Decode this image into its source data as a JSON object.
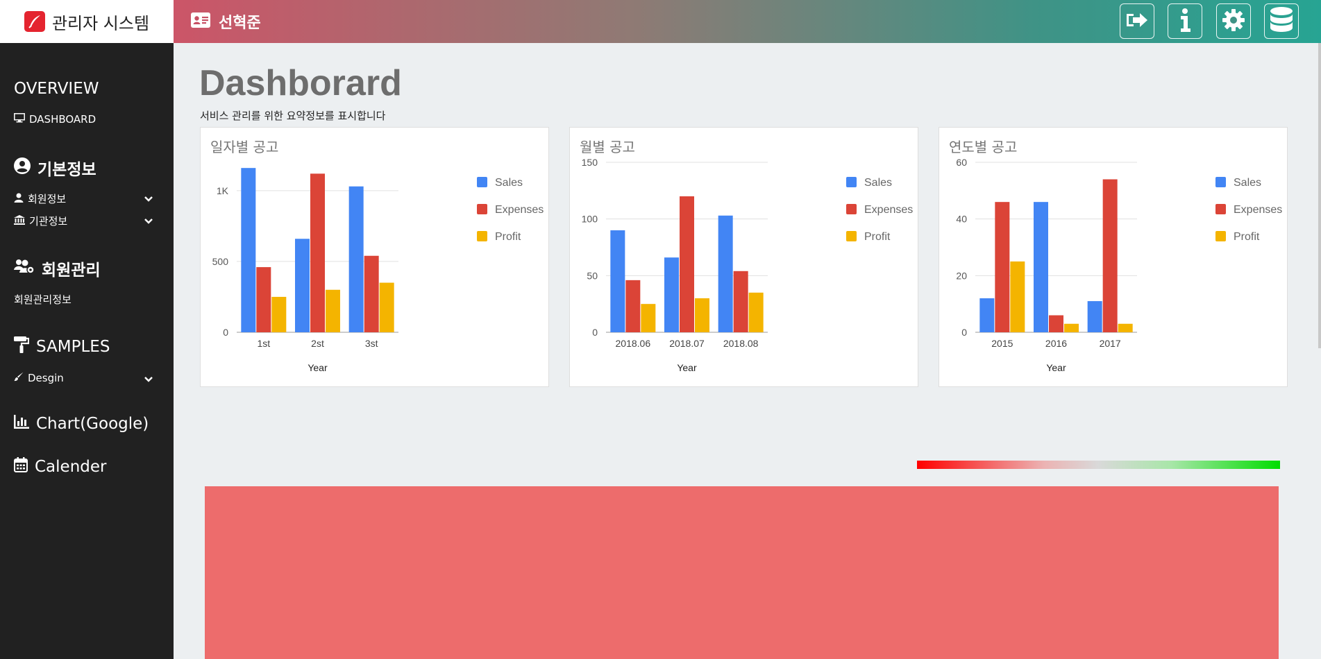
{
  "brand": {
    "title": "관리자 시스템",
    "logo_icon": "quill-icon",
    "logo_color": "#e4242f"
  },
  "header": {
    "user_name": "선혁준",
    "user_icon": "id-card-icon",
    "buttons": [
      "sign-out-icon",
      "info-icon",
      "gear-icon",
      "database-icon"
    ]
  },
  "sidebar": {
    "overview": {
      "title": "OVERVIEW",
      "items": [
        {
          "label": "DASHBOARD",
          "icon": "monitor-icon"
        }
      ]
    },
    "basic": {
      "title": "기본정보",
      "icon": "user-circle-icon",
      "items": [
        {
          "label": "회원정보",
          "icon": "user-icon"
        },
        {
          "label": "기관정보",
          "icon": "institution-icon"
        }
      ]
    },
    "members": {
      "title": "회원관리",
      "icon": "users-gear-icon",
      "items": [
        {
          "label": "회원관리정보"
        }
      ]
    },
    "samples": {
      "title": "SAMPLES",
      "icon": "paint-roller-icon",
      "items": [
        {
          "label": "Desgin",
          "icon": "paint-brush-icon"
        }
      ]
    },
    "chart": {
      "title": "Chart(Google)",
      "icon": "bar-chart-icon"
    },
    "calendar": {
      "title": "Calender",
      "icon": "calendar-icon"
    }
  },
  "main": {
    "title": "Dashborard",
    "subtitle": "서비스 관리를 위한 요약정보를 표시합니다"
  },
  "colors": {
    "sales": "#4285f4",
    "expenses": "#db4437",
    "profit": "#f4b400"
  },
  "chart_data": [
    {
      "type": "bar",
      "title": "일자별 공고",
      "xlabel": "Year",
      "categories": [
        "1st",
        "2st",
        "3st"
      ],
      "ylim": [
        0,
        1200
      ],
      "yticks": [
        0,
        500,
        1000
      ],
      "ytick_labels": [
        "0",
        "500",
        "1K"
      ],
      "legend": "right",
      "series": [
        {
          "name": "Sales",
          "values": [
            1160,
            660,
            1030
          ]
        },
        {
          "name": "Expenses",
          "values": [
            460,
            1120,
            540
          ]
        },
        {
          "name": "Profit",
          "values": [
            250,
            300,
            350
          ]
        }
      ]
    },
    {
      "type": "bar",
      "title": "월별 공고",
      "xlabel": "Year",
      "categories": [
        "2018.06",
        "2018.07",
        "2018.08"
      ],
      "ylim": [
        0,
        150
      ],
      "yticks": [
        0,
        50,
        100,
        150
      ],
      "ytick_labels": [
        "0",
        "50",
        "100",
        "150"
      ],
      "legend": "right",
      "series": [
        {
          "name": "Sales",
          "values": [
            90,
            66,
            103
          ]
        },
        {
          "name": "Expenses",
          "values": [
            46,
            120,
            54
          ]
        },
        {
          "name": "Profit",
          "values": [
            25,
            30,
            35
          ]
        }
      ]
    },
    {
      "type": "bar",
      "title": "연도별 공고",
      "xlabel": "Year",
      "categories": [
        "2015",
        "2016",
        "2017"
      ],
      "ylim": [
        0,
        60
      ],
      "yticks": [
        0,
        20,
        40,
        60
      ],
      "ytick_labels": [
        "0",
        "20",
        "40",
        "60"
      ],
      "legend": "right",
      "series": [
        {
          "name": "Sales",
          "values": [
            12,
            46,
            11
          ]
        },
        {
          "name": "Expenses",
          "values": [
            46,
            6,
            54
          ]
        },
        {
          "name": "Profit",
          "values": [
            25,
            3,
            3
          ]
        }
      ]
    }
  ]
}
